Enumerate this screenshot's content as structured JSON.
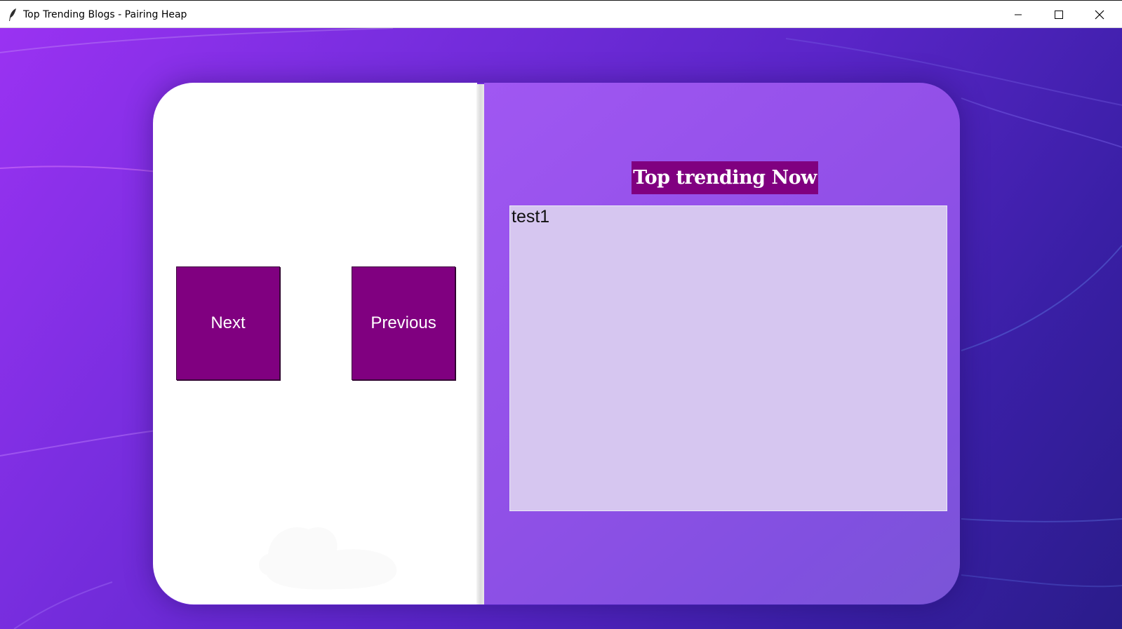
{
  "window": {
    "title": "Top Trending Blogs - Pairing Heap",
    "controls": {
      "minimize_icon": "minimize-icon",
      "maximize_icon": "maximize-icon",
      "close_icon": "close-icon"
    }
  },
  "controls": {
    "next_label": "Next",
    "previous_label": "Previous"
  },
  "trending": {
    "heading": "Top trending Now",
    "items": [
      "test1"
    ]
  },
  "colors": {
    "button": "#800080",
    "heading_bg": "#800080",
    "listbox_bg": "#d6c6f0",
    "panel_accent": "#9a55ec"
  }
}
